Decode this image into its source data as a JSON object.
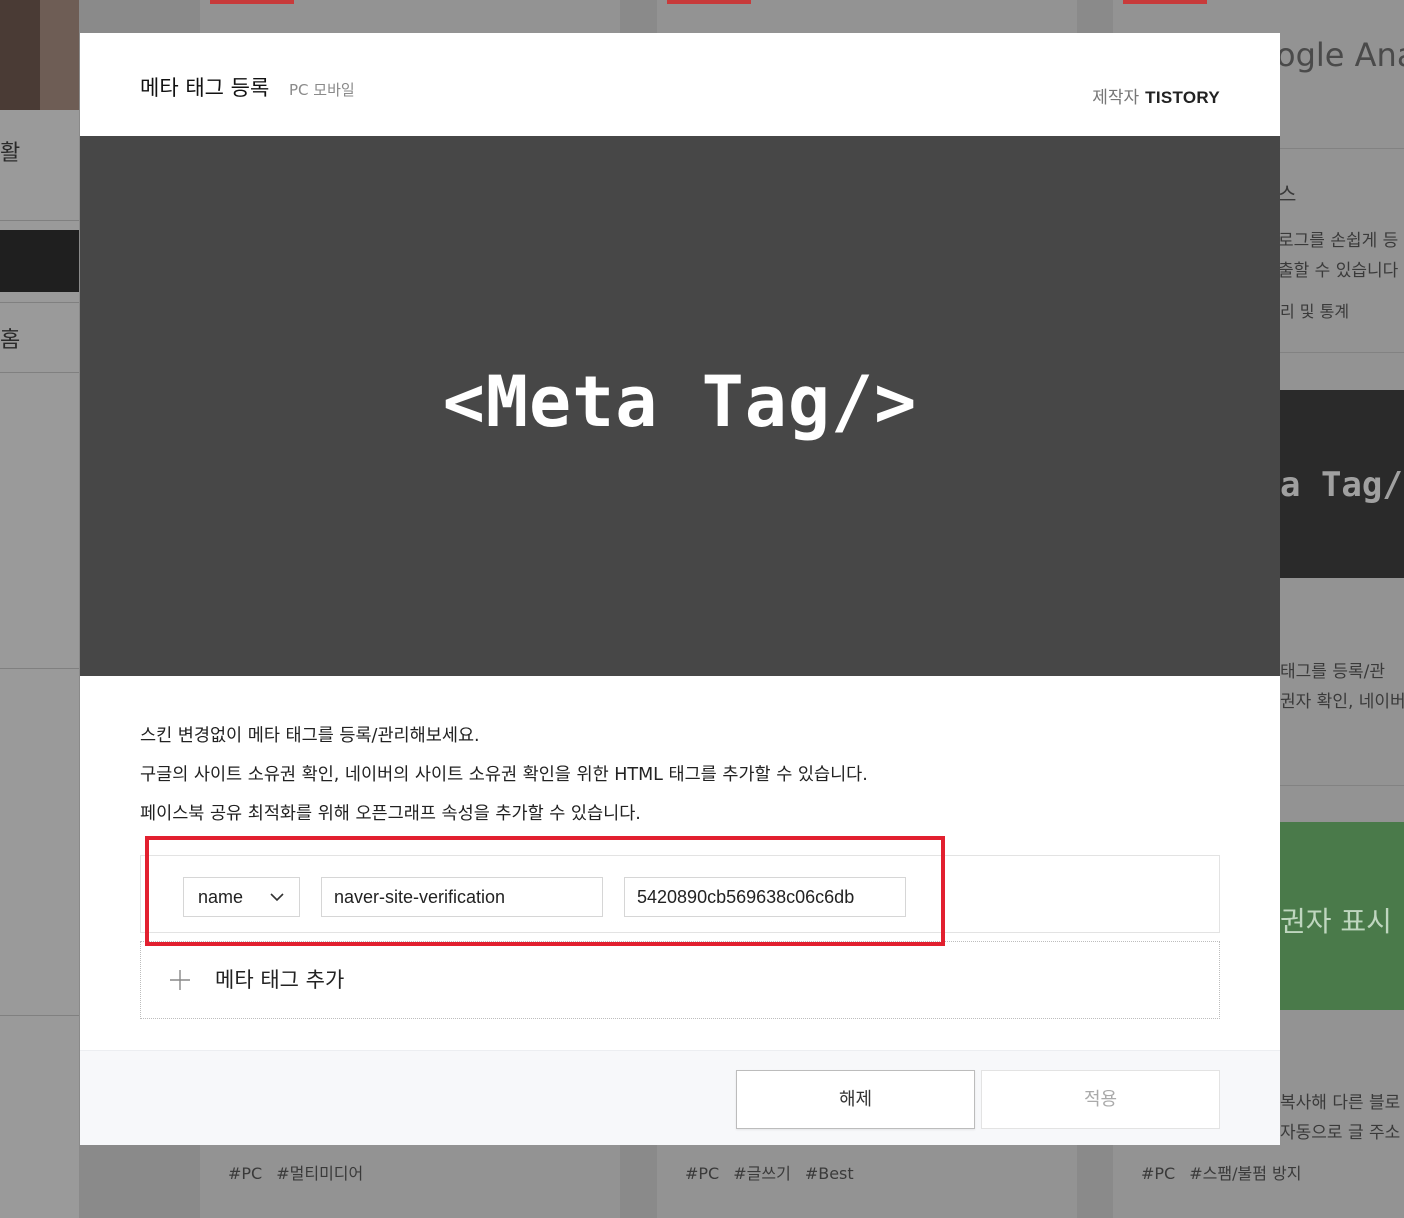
{
  "background": {
    "sidebar_text_1": "활",
    "sidebar_text_2": "홈",
    "right_texts": [
      "ogle Anal",
      "스",
      "로그를 손쉽게 등",
      "출할 수 있습니다",
      "리 및 통계",
      "태그를 등록/관",
      "권자 확인, 네이버의",
      "복사해 다른 블로",
      "자동으로 글 주소"
    ],
    "right_dark_text": "a Tag/",
    "right_green_text": "권자 표시",
    "tags_col1": [
      "#PC",
      "#멀티미디어"
    ],
    "tags_col2": [
      "#PC",
      "#글쓰기",
      "#Best"
    ],
    "tags_col3": [
      "#PC",
      "#스팸/불펌 방지"
    ]
  },
  "modal": {
    "title": "메타 태그 등록",
    "subtitle": "PC 모바일",
    "maker_label": "제작자",
    "maker_value": "TISTORY",
    "preview_text": "<Meta Tag/>",
    "description": [
      "스킨 변경없이 메타 태그를 등록/관리해보세요.",
      "구글의 사이트 소유권 확인, 네이버의 사이트 소유권 확인을 위한 HTML 태그를 추가할 수 있습니다.",
      "페이스북 공유 최적화를 위해 오픈그래프 속성을 추가할 수 있습니다."
    ],
    "meta_tag": {
      "attribute_select": "name",
      "name_value": "naver-site-verification",
      "content_value": "5420890cb569638c06c6db"
    },
    "add_label": "메타 태그 추가",
    "buttons": {
      "release": "해제",
      "apply": "적용"
    },
    "highlight_color": "#e2202f"
  }
}
